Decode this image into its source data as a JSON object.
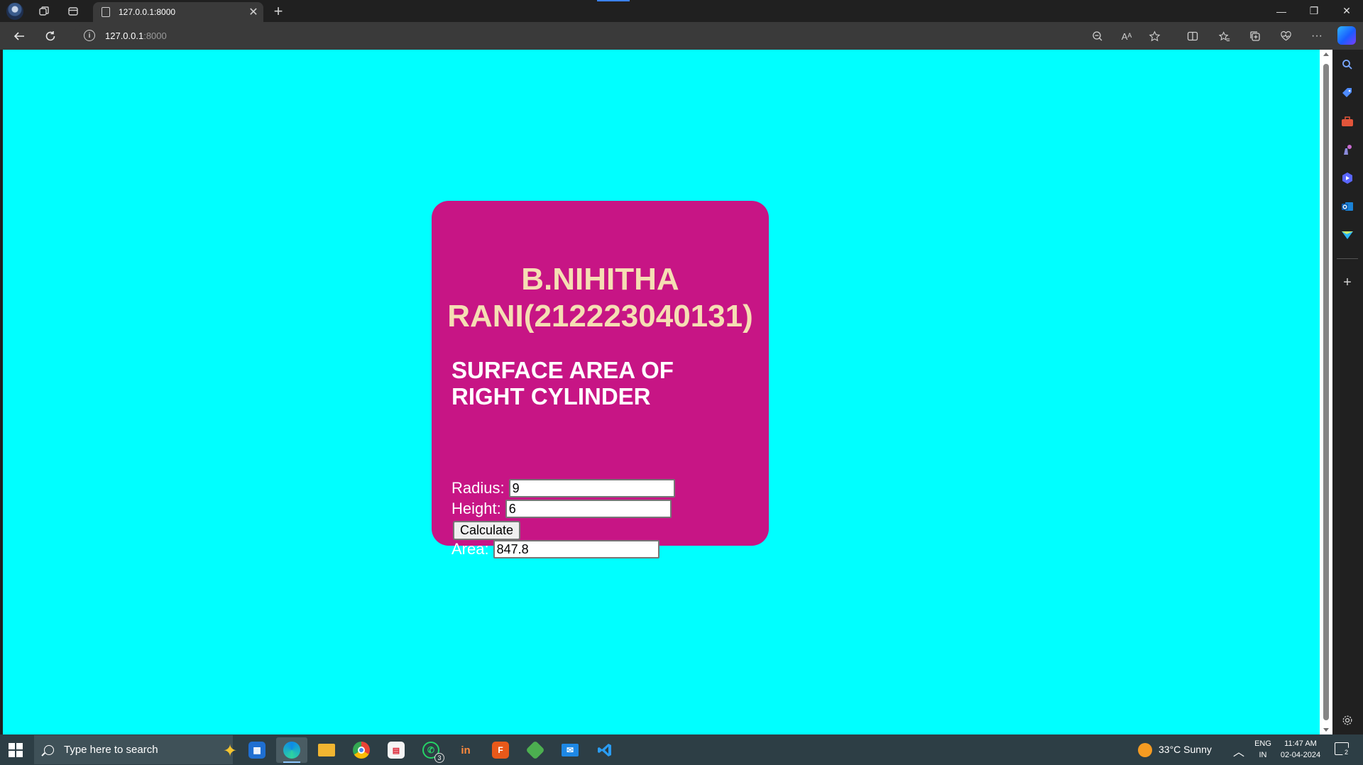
{
  "browser": {
    "tab_title": "127.0.0.1:8000",
    "tab_close_glyph": "✕",
    "new_tab_glyph": "+",
    "url_host": "127.0.0.1",
    "url_port": ":8000",
    "window_controls": {
      "minimize": "—",
      "restore": "❐",
      "close": "✕"
    },
    "toolbar_icons": [
      "zoom-out-icon",
      "read-aloud-icon",
      "favorite-star-icon",
      "split-screen-icon",
      "favorites-icon",
      "collections-icon",
      "browser-essentials-icon",
      "more-icon"
    ],
    "read_aloud_label": "Aᴬ",
    "more_glyph": "···"
  },
  "page": {
    "background_color": "#00ffff",
    "card_color": "#c71585",
    "name_line1": "B.NIHITHA",
    "name_line2": "RANI(212223040131)",
    "subtitle_line1": "SURFACE AREA OF",
    "subtitle_line2": "RIGHT CYLINDER",
    "radius_label": "Radius:",
    "radius_value": "9",
    "height_label": "Height:",
    "height_value": "6",
    "calculate_label": "Calculate",
    "area_label": "Area:",
    "area_value": "847.8"
  },
  "sidebar": {
    "icons": [
      "search-icon",
      "shopping-tag-icon",
      "tools-icon",
      "games-icon",
      "copilot-icon",
      "outlook-icon",
      "send-icon",
      "add-icon",
      "settings-icon"
    ]
  },
  "taskbar": {
    "search_placeholder": "Type here to search",
    "apps": [
      "store-icon",
      "edge-icon",
      "file-explorer-icon",
      "chrome-icon",
      "app-icon",
      "whatsapp-icon",
      "app-icon",
      "app-icon",
      "app-icon",
      "mail-icon",
      "vscode-icon"
    ],
    "whatsapp_badge": "3",
    "weather": "33°C  Sunny",
    "language_top": "ENG",
    "language_bottom": "IN",
    "time": "11:47 AM",
    "date": "02-04-2024",
    "notification_count": "2"
  }
}
